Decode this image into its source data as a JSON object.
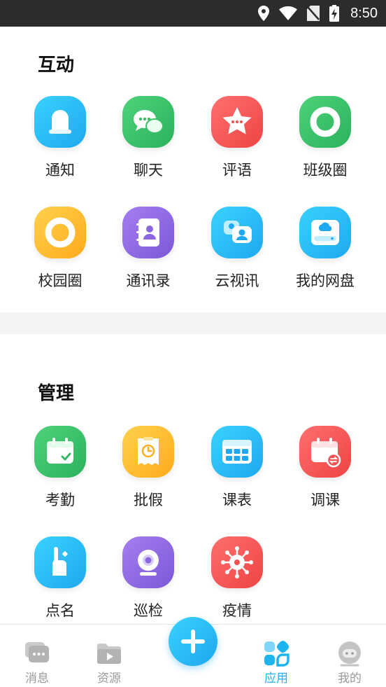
{
  "status_bar": {
    "time": "8:50"
  },
  "sections": {
    "interaction": {
      "title": "互动",
      "apps": [
        {
          "label": "通知",
          "icon": "bell-icon"
        },
        {
          "label": "聊天",
          "icon": "chat-bubbles-icon"
        },
        {
          "label": "评语",
          "icon": "star-comment-icon"
        },
        {
          "label": "班级圈",
          "icon": "ring-icon"
        },
        {
          "label": "校园圈",
          "icon": "ring-icon"
        },
        {
          "label": "通讯录",
          "icon": "contacts-book-icon"
        },
        {
          "label": "云视讯",
          "icon": "video-chat-icon"
        },
        {
          "label": "我的网盘",
          "icon": "cloud-drive-icon"
        }
      ]
    },
    "management": {
      "title": "管理",
      "apps": [
        {
          "label": "考勤",
          "icon": "calendar-check-icon"
        },
        {
          "label": "批假",
          "icon": "leave-clock-icon"
        },
        {
          "label": "课表",
          "icon": "timetable-icon"
        },
        {
          "label": "调课",
          "icon": "calendar-swap-icon"
        },
        {
          "label": "点名",
          "icon": "hand-raise-icon"
        },
        {
          "label": "巡检",
          "icon": "webcam-icon"
        },
        {
          "label": "疫情",
          "icon": "virus-icon"
        }
      ]
    }
  },
  "bottom_nav": {
    "items": [
      {
        "label": "消息",
        "icon": "messages-icon",
        "active": false
      },
      {
        "label": "资源",
        "icon": "video-folder-icon",
        "active": false
      },
      {
        "label": "应用",
        "icon": "apps-icon",
        "active": true
      },
      {
        "label": "我的",
        "icon": "profile-icon",
        "active": false
      }
    ],
    "fab_icon": "plus-icon"
  },
  "colors": {
    "accent": "#1eb4f0",
    "inactive": "#9a9a9a"
  }
}
